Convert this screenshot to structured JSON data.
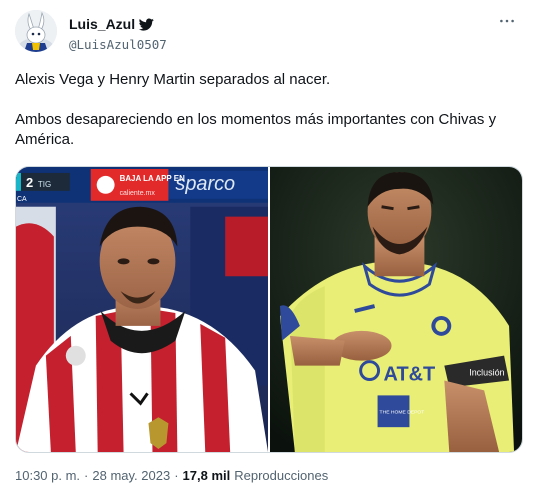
{
  "author": {
    "display_name": "Luis_Azul",
    "handle": "@LuisAzul0507",
    "verified_icon": "bird-badge-icon",
    "avatar_icon": "rabbit-mascot-avatar"
  },
  "menu": {
    "more_icon": "more-horizontal-icon",
    "more_glyph": "···"
  },
  "tweet": {
    "lines": [
      "Alexis Vega y Henry Martin separados al nacer.",
      "Ambos desapareciendo en los momentos más importantes con Chivas y América."
    ]
  },
  "media": {
    "left_photo": {
      "scoreboard": "2",
      "scoreboard_team": "TIG",
      "sponsor_text": "BAJA LA APP EN",
      "sponsor_url": "caliente.mx",
      "sponsor_logo": "caliente",
      "banner": "sparco",
      "corner_text": "CA"
    },
    "right_photo": {
      "sponsor": "AT&T",
      "sleeve": "THE HOME DEPOT",
      "armband": "Inclusión"
    }
  },
  "footer": {
    "time": "10:30 p. m.",
    "separator": "·",
    "date": "28 may. 2023",
    "views": "17,8 mil",
    "views_label": "Reproducciones"
  },
  "colors": {
    "text": "#0f1419",
    "secondary": "#536471",
    "border": "#cfd9de",
    "verified": "#1d9bf0"
  }
}
